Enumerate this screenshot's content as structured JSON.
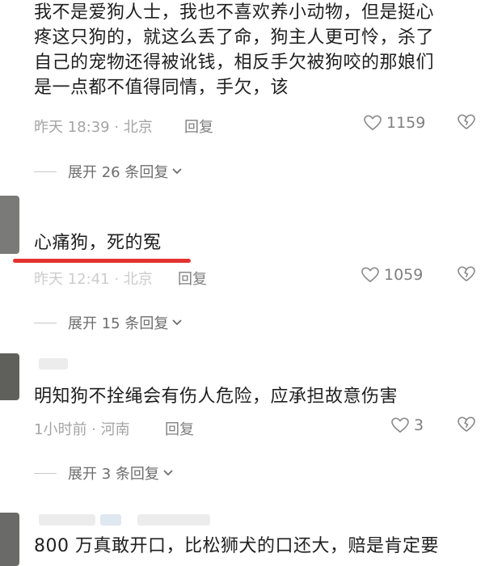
{
  "comments": [
    {
      "text_lines": [
        "我不是爱狗人士，我也不喜欢养小动物，但是挺心",
        "疼这只狗的，就这么丢了命，狗主人更可怜，杀了",
        "自己的宠物还得被讹钱，相反手欠被狗咬的那娘们",
        "是一点都不值得同情，手欠，该"
      ],
      "meta": "昨天 18:39 · 北京",
      "reply": "回复",
      "likes": "1159",
      "expand": "展开 26 条回复"
    },
    {
      "text": "心痛狗，死的冤",
      "meta": "昨天 12:41 · 北京",
      "reply": "回复",
      "likes": "1059",
      "expand": "展开 15 条回复"
    },
    {
      "text": "明知狗不拴绳会有伤人危险，应承担故意伤害",
      "meta": "1小时前 · 河南",
      "reply": "回复",
      "likes": "3",
      "expand": "展开 3 条回复"
    },
    {
      "text_lines": [
        "800 万真敢开口，比松狮犬的口还大，赔是肯定要"
      ]
    }
  ],
  "colors": {
    "highlight": "#e2322f",
    "meta_text": "#a4a4a4",
    "body_text": "#1f1f1f"
  }
}
